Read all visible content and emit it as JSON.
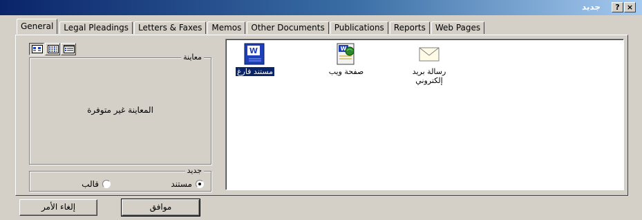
{
  "window": {
    "title": "جديد",
    "help_label": "?",
    "close_label": "×"
  },
  "tabs": [
    {
      "label": "General",
      "active": true
    },
    {
      "label": "Legal Pleadings"
    },
    {
      "label": "Letters & Faxes"
    },
    {
      "label": "Memos"
    },
    {
      "label": "Other Documents"
    },
    {
      "label": "Publications"
    },
    {
      "label": "Reports"
    },
    {
      "label": "Web Pages"
    }
  ],
  "view_buttons": [
    "large-icons-view-icon",
    "list-view-icon",
    "details-view-icon"
  ],
  "preview": {
    "label": "معاينة",
    "unavailable_text": "المعاينة غير متوفرة"
  },
  "create_new": {
    "label": "جديد",
    "document_label": "مستند",
    "template_label": "قالب",
    "selected": "document"
  },
  "templates": [
    {
      "label": "مستند فارغ",
      "icon": "blank-document-icon",
      "selected": true
    },
    {
      "label": "صفحة ويب",
      "icon": "web-page-icon"
    },
    {
      "label": "رسالة بريد إلكتروني",
      "icon": "email-message-icon"
    }
  ],
  "buttons": {
    "ok": "موافق",
    "cancel": "إلغاء الأمر"
  },
  "colors": {
    "titlebar": "#0a246a",
    "dialog": "#d4d0c8",
    "selection": "#0a246a",
    "doc_icon": "#1f3fb8"
  }
}
